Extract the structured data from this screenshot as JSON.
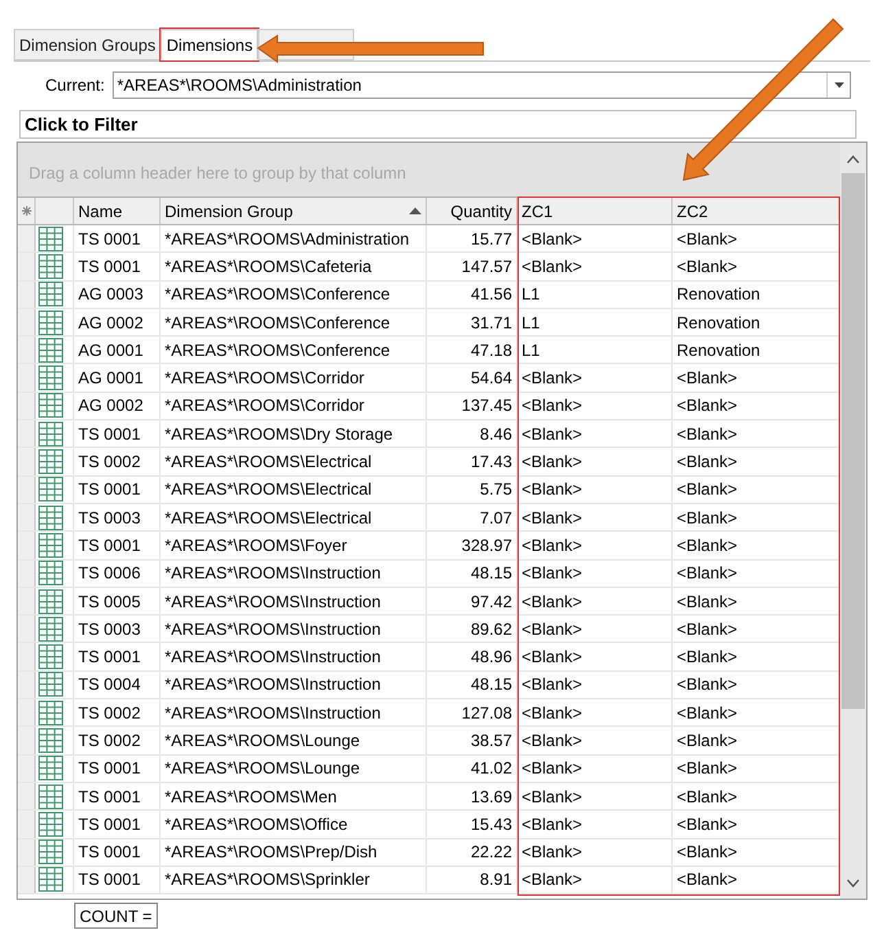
{
  "tabs": [
    {
      "label": "Dimension Groups",
      "selected": false,
      "highlighted": false,
      "callout": false
    },
    {
      "label": "Dimensions",
      "selected": true,
      "highlighted": true,
      "callout": true
    },
    {
      "selected": false,
      "highlighted": false,
      "callout": false
    }
  ],
  "current": {
    "label": "Current:",
    "value": "*AREAS*\\ROOMS\\Administration"
  },
  "filter": {
    "text": "Click to Filter"
  },
  "group_panel": {
    "hint": "Drag a column header here to group by that column"
  },
  "columns": [
    {
      "label": "Name",
      "highlighted": false
    },
    {
      "label": "Dimension Group",
      "sorted": true,
      "highlighted": false
    },
    {
      "label": "Quantity",
      "kind": "numeric",
      "highlighted": false
    },
    {
      "label": "ZC1",
      "highlighted": true
    },
    {
      "label": "ZC2",
      "highlighted": true
    }
  ],
  "rows": [
    [
      "TS 0001",
      "*AREAS*\\ROOMS\\Administration",
      "15.77",
      "<Blank>",
      "<Blank>"
    ],
    [
      "TS 0001",
      "*AREAS*\\ROOMS\\Cafeteria",
      "147.57",
      "<Blank>",
      "<Blank>"
    ],
    [
      "AG 0003",
      "*AREAS*\\ROOMS\\Conference",
      "41.56",
      "L1",
      "Renovation"
    ],
    [
      "AG 0002",
      "*AREAS*\\ROOMS\\Conference",
      "31.71",
      "L1",
      "Renovation"
    ],
    [
      "AG 0001",
      "*AREAS*\\ROOMS\\Conference",
      "47.18",
      "L1",
      "Renovation"
    ],
    [
      "AG 0001",
      "*AREAS*\\ROOMS\\Corridor",
      "54.64",
      "<Blank>",
      "<Blank>"
    ],
    [
      "AG 0002",
      "*AREAS*\\ROOMS\\Corridor",
      "137.45",
      "<Blank>",
      "<Blank>"
    ],
    [
      "TS 0001",
      "*AREAS*\\ROOMS\\Dry Storage",
      "8.46",
      "<Blank>",
      "<Blank>"
    ],
    [
      "TS 0002",
      "*AREAS*\\ROOMS\\Electrical",
      "17.43",
      "<Blank>",
      "<Blank>"
    ],
    [
      "TS 0001",
      "*AREAS*\\ROOMS\\Electrical",
      "5.75",
      "<Blank>",
      "<Blank>"
    ],
    [
      "TS 0003",
      "*AREAS*\\ROOMS\\Electrical",
      "7.07",
      "<Blank>",
      "<Blank>"
    ],
    [
      "TS 0001",
      "*AREAS*\\ROOMS\\Foyer",
      "328.97",
      "<Blank>",
      "<Blank>"
    ],
    [
      "TS 0006",
      "*AREAS*\\ROOMS\\Instruction",
      "48.15",
      "<Blank>",
      "<Blank>"
    ],
    [
      "TS 0005",
      "*AREAS*\\ROOMS\\Instruction",
      "97.42",
      "<Blank>",
      "<Blank>"
    ],
    [
      "TS 0003",
      "*AREAS*\\ROOMS\\Instruction",
      "89.62",
      "<Blank>",
      "<Blank>"
    ],
    [
      "TS 0001",
      "*AREAS*\\ROOMS\\Instruction",
      "48.96",
      "<Blank>",
      "<Blank>"
    ],
    [
      "TS 0004",
      "*AREAS*\\ROOMS\\Instruction",
      "48.15",
      "<Blank>",
      "<Blank>"
    ],
    [
      "TS 0002",
      "*AREAS*\\ROOMS\\Instruction",
      "127.08",
      "<Blank>",
      "<Blank>"
    ],
    [
      "TS 0002",
      "*AREAS*\\ROOMS\\Lounge",
      "38.57",
      "<Blank>",
      "<Blank>"
    ],
    [
      "TS 0001",
      "*AREAS*\\ROOMS\\Lounge",
      "41.02",
      "<Blank>",
      "<Blank>"
    ],
    [
      "TS 0001",
      "*AREAS*\\ROOMS\\Men",
      "13.69",
      "<Blank>",
      "<Blank>"
    ],
    [
      "TS 0001",
      "*AREAS*\\ROOMS\\Office",
      "15.43",
      "<Blank>",
      "<Blank>"
    ],
    [
      "TS 0001",
      "*AREAS*\\ROOMS\\Prep/Dish",
      "22.22",
      "<Blank>",
      "<Blank>"
    ],
    [
      "TS 0001",
      "*AREAS*\\ROOMS\\Sprinkler",
      "8.91",
      "<Blank>",
      "<Blank>"
    ]
  ],
  "footer": {
    "summary": "COUNT ="
  },
  "column_highlight_callout": true
}
